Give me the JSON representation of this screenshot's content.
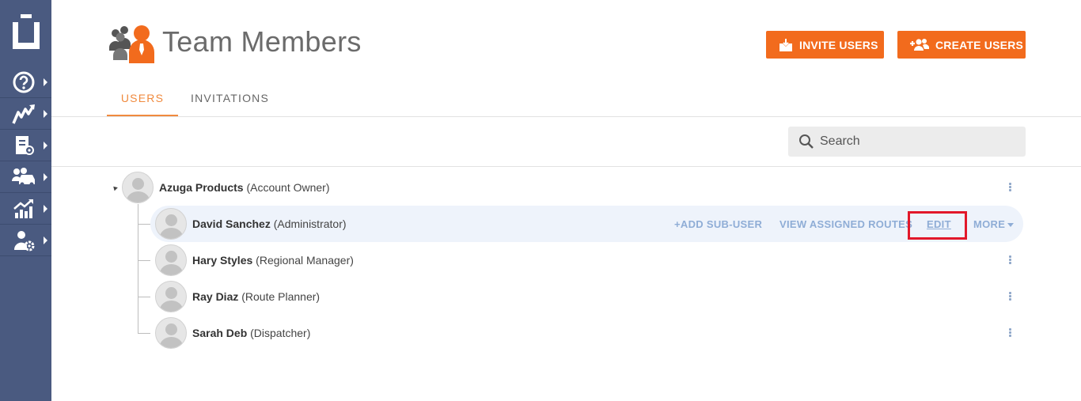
{
  "sidebar": {
    "logo_icon": "app-logo-icon",
    "items": [
      {
        "icon": "help-icon"
      },
      {
        "icon": "routes-icon"
      },
      {
        "icon": "route-plan-icon"
      },
      {
        "icon": "team-vehicles-icon"
      },
      {
        "icon": "analytics-icon"
      },
      {
        "icon": "user-settings-icon"
      }
    ]
  },
  "header": {
    "title": "Team Members",
    "title_icon": "team-members-icon",
    "invite_label": "INVITE USERS",
    "create_label": "CREATE USERS"
  },
  "tabs": {
    "users": "USERS",
    "invitations": "INVITATIONS",
    "active": "USERS"
  },
  "search": {
    "placeholder": "Search"
  },
  "tree": {
    "root": {
      "name": "Azuga Products",
      "role": "(Account Owner)"
    },
    "children": [
      {
        "name": "David Sanchez",
        "role": "(Administrator)"
      },
      {
        "name": "Hary Styles",
        "role": "(Regional Manager)"
      },
      {
        "name": "Ray Diaz",
        "role": "(Route Planner)"
      },
      {
        "name": "Sarah Deb",
        "role": "(Dispatcher)"
      }
    ]
  },
  "row_actions": {
    "add_sub_user": "+ADD SUB-USER",
    "view_routes": "VIEW ASSIGNED ROUTES",
    "edit": "EDIT",
    "more": "MORE"
  },
  "colors": {
    "sidebar": "#4a5a80",
    "accent": "#f26b1d",
    "link": "#8fadd6",
    "highlight_box": "#e2182a"
  }
}
